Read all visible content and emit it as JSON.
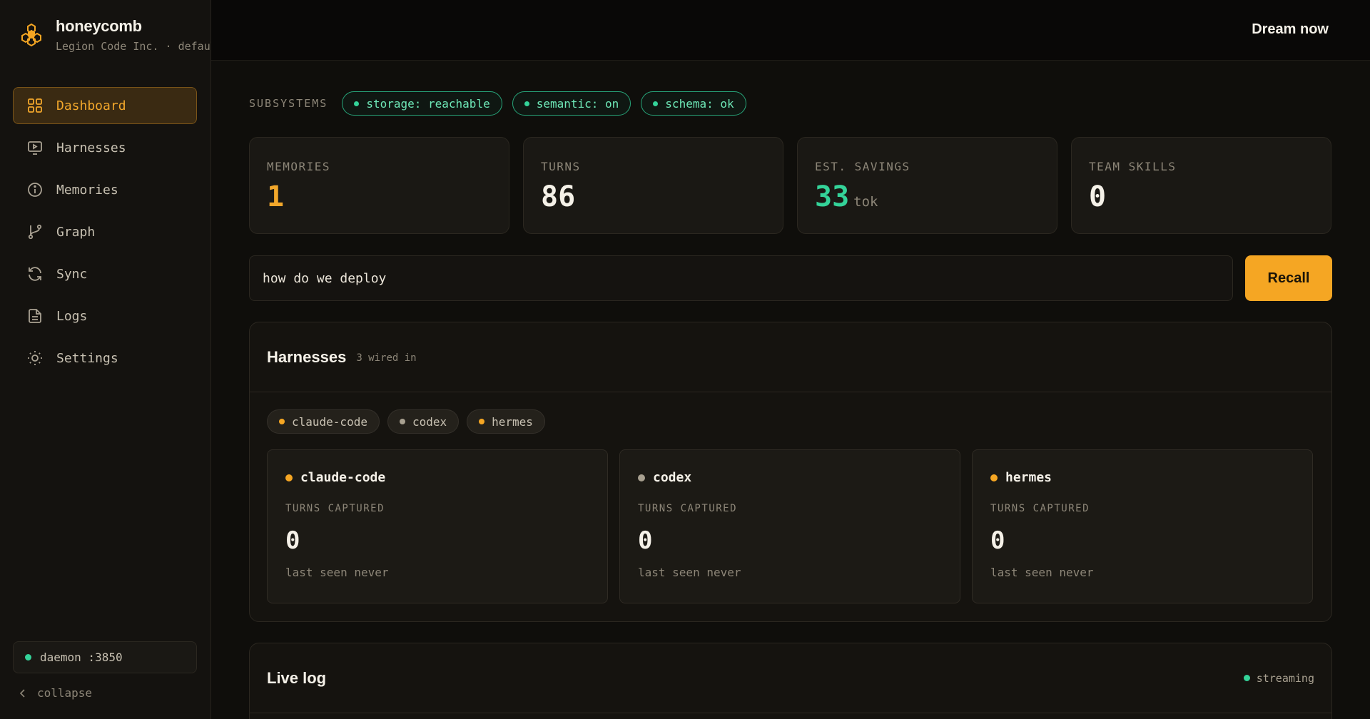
{
  "app": {
    "name": "honeycomb",
    "org": "Legion Code Inc. · default"
  },
  "sidebar": {
    "items": [
      {
        "label": "Dashboard",
        "icon": "grid-icon",
        "active": true
      },
      {
        "label": "Harnesses",
        "icon": "monitor-play-icon"
      },
      {
        "label": "Memories",
        "icon": "info-circle-icon"
      },
      {
        "label": "Graph",
        "icon": "git-branch-icon"
      },
      {
        "label": "Sync",
        "icon": "refresh-icon"
      },
      {
        "label": "Logs",
        "icon": "file-text-icon"
      },
      {
        "label": "Settings",
        "icon": "sun-gear-icon"
      }
    ],
    "daemon": "daemon :3850",
    "collapse": "collapse"
  },
  "topbar": {
    "action": "Dream now"
  },
  "subsystems": {
    "label": "SUBSYSTEMS",
    "pills": [
      "storage: reachable",
      "semantic: on",
      "schema: ok"
    ]
  },
  "stats": [
    {
      "label": "MEMORIES",
      "value": "1",
      "unit": "",
      "color": "#f2a72b"
    },
    {
      "label": "TURNS",
      "value": "86",
      "unit": "",
      "color": "#f5f1e8"
    },
    {
      "label": "EST. SAVINGS",
      "value": "33",
      "unit": "tok",
      "color": "#34d399"
    },
    {
      "label": "TEAM SKILLS",
      "value": "0",
      "unit": "",
      "color": "#f5f1e8"
    }
  ],
  "search": {
    "value": "how do we deploy",
    "button": "Recall"
  },
  "harnesses": {
    "title": "Harnesses",
    "subtitle": "3 wired in",
    "chips": [
      {
        "name": "claude-code",
        "status_color": "#f5a623"
      },
      {
        "name": "codex",
        "status_color": "#a8a090"
      },
      {
        "name": "hermes",
        "status_color": "#f5a623"
      }
    ],
    "cards": [
      {
        "name": "claude-code",
        "label": "TURNS CAPTURED",
        "value": "0",
        "seen": "last seen never"
      },
      {
        "name": "codex",
        "label": "TURNS CAPTURED",
        "value": "0",
        "seen": "last seen never"
      },
      {
        "name": "hermes",
        "label": "TURNS CAPTURED",
        "value": "0",
        "seen": "last seen never"
      }
    ]
  },
  "live_log": {
    "title": "Live log",
    "status": "streaming"
  },
  "colors": {
    "accent": "#f5a623",
    "success": "#34d399"
  }
}
